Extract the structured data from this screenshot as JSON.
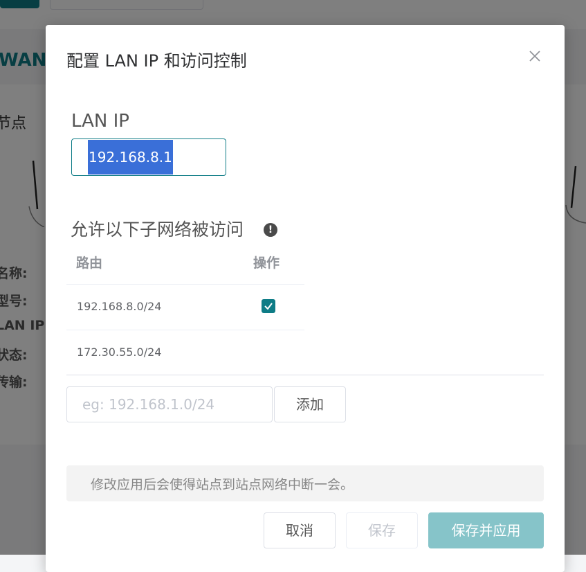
{
  "background": {
    "section_title": "WAN",
    "node_heading": "节点",
    "field_labels": [
      "名称:",
      "型号:",
      "LAN IP:",
      "状态:",
      "传输:"
    ]
  },
  "dialog": {
    "title": "配置 LAN IP 和访问控制",
    "close_icon": "close-icon",
    "lan_ip_label": "LAN IP",
    "lan_ip_value": "192.168.8.1",
    "subnet_title": "允许以下子网络被访问",
    "info_icon": "info-icon",
    "table": {
      "headers": {
        "route": "路由",
        "action": "操作"
      },
      "rows": [
        {
          "route": "192.168.8.0/24",
          "checked": true
        },
        {
          "route": "172.30.55.0/24",
          "checked": false
        }
      ]
    },
    "add_input": {
      "placeholder": "eg: 192.168.1.0/24",
      "value": ""
    },
    "add_button": "添加",
    "notice": "修改应用后会使得站点到站点网络中断一会。",
    "buttons": {
      "cancel": "取消",
      "save": "保存",
      "save_apply": "保存并应用"
    }
  },
  "colors": {
    "accent": "#0e7c86",
    "selection": "#3a6fd8",
    "disabled_primary": "#86c4c9"
  }
}
